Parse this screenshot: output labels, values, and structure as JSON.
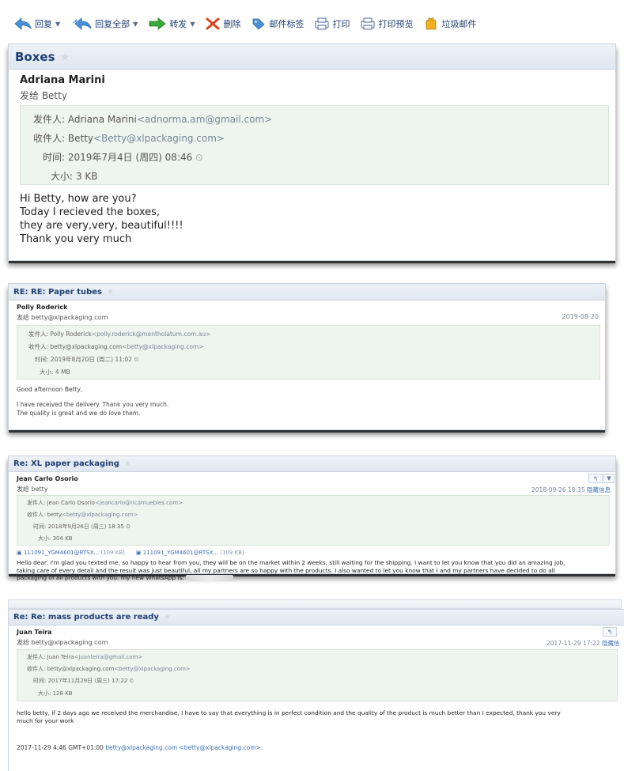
{
  "toolbar": {
    "reply": "回复",
    "reply_all": "回复全部",
    "forward": "转发",
    "delete": "删除",
    "mail_tag": "邮件标签",
    "print": "打印",
    "print_preview": "打印预览",
    "spam": "垃圾邮件"
  },
  "email1": {
    "subject": "Boxes",
    "sender": "Adriana Marini",
    "to_line": "发给 Betty",
    "from_label": "发件人:",
    "from_name": "Adriana Marini",
    "from_email": "<adnorma.am@gmail.com>",
    "to_label": "收件人:",
    "to_name": "Betty",
    "to_email": "<Betty@xlpackaging.com>",
    "time_label": "时间:",
    "time_value": "2019年7月4日 (周四) 08:46",
    "size_label": "大小:",
    "size_value": "3 KB",
    "body": [
      "Hi Betty, how are you?",
      "Today I recieved the boxes,",
      "they are very,very, beautiful!!!!",
      "Thank you very much"
    ]
  },
  "email2": {
    "subject": "RE: RE: Paper tubes",
    "sender": "Polly Roderick",
    "to_line": "发给 betty@xlpackaging.com",
    "date": "2019-08-20",
    "from_label": "发件人:",
    "from_name": "Polly Roderick",
    "from_email": "<polly.roderick@mentholatum.com.au>",
    "to_label": "收件人:",
    "to_name": "betty@xlpackaging.com",
    "to_email": "<betty@xlpackaging.com>",
    "time_label": "时间:",
    "time_value": "2019年8月20日 (周二) 11:02",
    "size_label": "大小:",
    "size_value": "4 MB",
    "body": [
      "Good afternoon Betty,",
      "I have received the delivery. Thank you very much.",
      "The quality is great and we do love them."
    ]
  },
  "email3": {
    "subject": "Re: XL paper packaging",
    "sender": "Jean Carlo Osorio",
    "to_line": "发给 betty",
    "date": "2018-09-26 18:35",
    "hide": "隐藏信息",
    "from_label": "发件人:",
    "from_name": "Jean Carlo Osorio",
    "from_email": "<jeancarlo@ricamuebles.com>",
    "to_label": "收件人:",
    "to_name": "betty",
    "to_email": "<betty@xlpackaging.com>",
    "time_label": "时间:",
    "time_value": "2018年9月26日 (周三) 18:35",
    "size_label": "大小:",
    "size_value": "304 KB",
    "attachments": [
      {
        "name": "111091_YGM4601@RTSX...",
        "size": "(109 KB)"
      },
      {
        "name": "111091_YGM4601@RTSX...",
        "size": "(109 KB)"
      }
    ],
    "body": [
      "Hello dear, I'm glad you texted me, so happy to hear from you, they will be on the market within 2 weeks, still waiting for the shipping. I want to let you know that you did an amazing job,",
      "taking care of every detail and the result was just beautiful, all my partners are so happy with the products. I also wanted to let you know that I and my partners have decided to do all",
      "packaging of all products with you. my new WhatsApp is:"
    ]
  },
  "email4": {
    "subject": "Re: Re: mass products are ready",
    "sender": "Juan Teira",
    "to_line": "发给 betty@xlpackaging.com",
    "date": "2017-11-29 17:22",
    "hide": "隐藏信",
    "from_label": "发件人:",
    "from_name": "Juan Teira",
    "from_email": "<juanteira@gmail.com>",
    "to_label": "收件人:",
    "to_name": "betty@xlpackaging.com",
    "to_email": "<betty@xlpackaging.com>",
    "time_label": "时间:",
    "time_value": "2017年11月29日 (周三) 17:22",
    "size_label": "大小:",
    "size_value": "128 KB",
    "body": [
      "hello betty, if 2 days ago we received the merchandise, I have to say that everything is in perfect condition and the quality of the product is much better than I expected, thank you very",
      "much for your work"
    ],
    "quote_prefix": "2017-11-29 4:46 GMT+01:00",
    "quote_email": "betty@xlpackaging.com <betty@xlpackaging.com>:"
  },
  "colors": {
    "toolbar_text": "#1f3f73",
    "subject_bar": "#e0e7f0",
    "header_bg": "#eef4ee",
    "link": "#3a6fb0"
  }
}
